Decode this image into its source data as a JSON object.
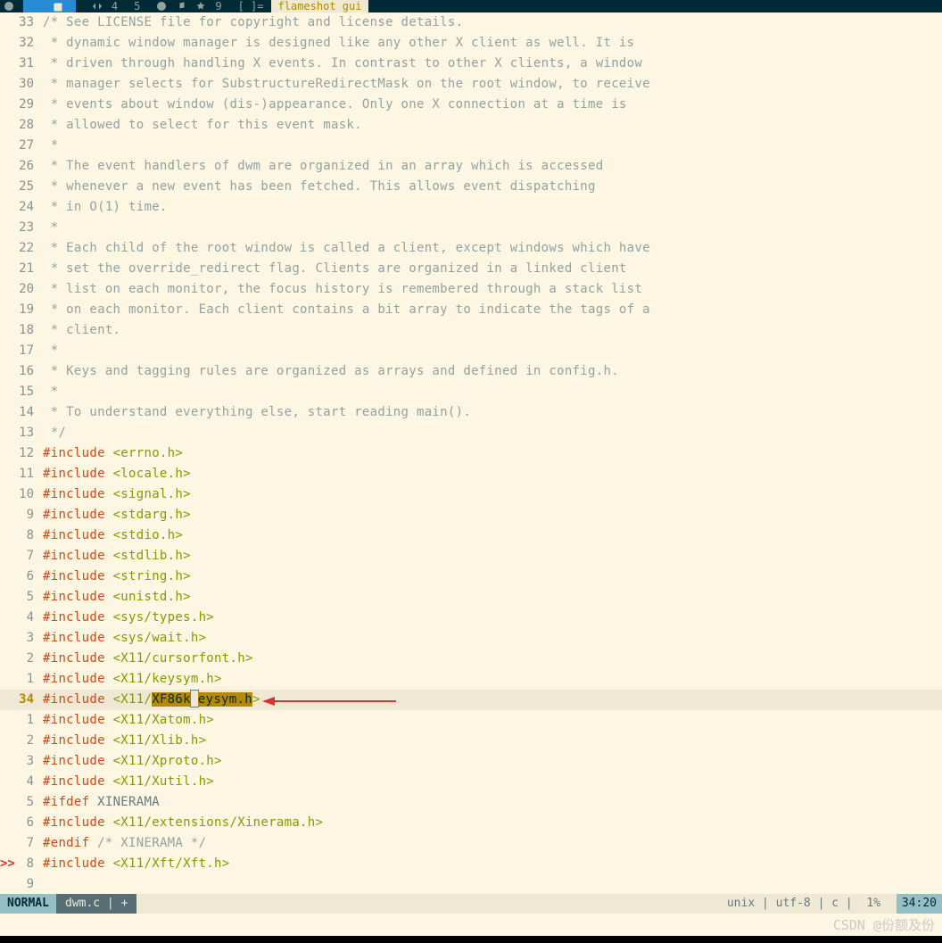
{
  "topbar": {
    "tags": [
      "",
      "",
      "",
      "4",
      "5",
      "",
      "",
      "",
      "9",
      "[ ]="
    ],
    "title": "flameshot gui"
  },
  "lines": [
    {
      "n": "33",
      "type": "comment",
      "text": "/* See LICENSE file for copyright and license details."
    },
    {
      "n": "32",
      "type": "comment",
      "text": " * dynamic window manager is designed like any other X client as well. It is"
    },
    {
      "n": "31",
      "type": "comment",
      "text": " * driven through handling X events. In contrast to other X clients, a window"
    },
    {
      "n": "30",
      "type": "comment",
      "text": " * manager selects for SubstructureRedirectMask on the root window, to receive"
    },
    {
      "n": "29",
      "type": "comment",
      "text": " * events about window (dis-)appearance. Only one X connection at a time is"
    },
    {
      "n": "28",
      "type": "comment",
      "text": " * allowed to select for this event mask."
    },
    {
      "n": "27",
      "type": "comment",
      "text": " *"
    },
    {
      "n": "26",
      "type": "comment",
      "text": " * The event handlers of dwm are organized in an array which is accessed"
    },
    {
      "n": "25",
      "type": "comment",
      "text": " * whenever a new event has been fetched. This allows event dispatching"
    },
    {
      "n": "24",
      "type": "comment",
      "text": " * in O(1) time."
    },
    {
      "n": "23",
      "type": "comment",
      "text": " *"
    },
    {
      "n": "22",
      "type": "comment",
      "text": " * Each child of the root window is called a client, except windows which have"
    },
    {
      "n": "21",
      "type": "comment",
      "text": " * set the override_redirect flag. Clients are organized in a linked client"
    },
    {
      "n": "20",
      "type": "comment",
      "text": " * list on each monitor, the focus history is remembered through a stack list"
    },
    {
      "n": "19",
      "type": "comment",
      "text": " * on each monitor. Each client contains a bit array to indicate the tags of a"
    },
    {
      "n": "18",
      "type": "comment",
      "text": " * client."
    },
    {
      "n": "17",
      "type": "comment",
      "text": " *"
    },
    {
      "n": "16",
      "type": "comment",
      "text": " * Keys and tagging rules are organized as arrays and defined in config.h."
    },
    {
      "n": "15",
      "type": "comment",
      "text": " *"
    },
    {
      "n": "14",
      "type": "comment",
      "text": " * To understand everything else, start reading main()."
    },
    {
      "n": "13",
      "type": "comment",
      "text": " */"
    },
    {
      "n": "12",
      "type": "include",
      "directive": "#include ",
      "header": "<errno.h>"
    },
    {
      "n": "11",
      "type": "include",
      "directive": "#include ",
      "header": "<locale.h>"
    },
    {
      "n": "10",
      "type": "include",
      "directive": "#include ",
      "header": "<signal.h>"
    },
    {
      "n": "9",
      "type": "include",
      "directive": "#include ",
      "header": "<stdarg.h>"
    },
    {
      "n": "8",
      "type": "include",
      "directive": "#include ",
      "header": "<stdio.h>"
    },
    {
      "n": "7",
      "type": "include",
      "directive": "#include ",
      "header": "<stdlib.h>"
    },
    {
      "n": "6",
      "type": "include",
      "directive": "#include ",
      "header": "<string.h>"
    },
    {
      "n": "5",
      "type": "include",
      "directive": "#include ",
      "header": "<unistd.h>"
    },
    {
      "n": "4",
      "type": "include",
      "directive": "#include ",
      "header": "<sys/types.h>"
    },
    {
      "n": "3",
      "type": "include",
      "directive": "#include ",
      "header": "<sys/wait.h>"
    },
    {
      "n": "2",
      "type": "include",
      "directive": "#include ",
      "header": "<X11/cursorfont.h>"
    },
    {
      "n": "1",
      "type": "include",
      "directive": "#include ",
      "header": "<X11/keysym.h>"
    },
    {
      "n": "34",
      "type": "current",
      "directive": "#include ",
      "header_pre": "<X11/",
      "header_hl1": "XF86k",
      "header_hl2": "eysym.h",
      "header_post": ">"
    },
    {
      "n": "1",
      "type": "include",
      "directive": "#include ",
      "header": "<X11/Xatom.h>"
    },
    {
      "n": "2",
      "type": "include",
      "directive": "#include ",
      "header": "<X11/Xlib.h>"
    },
    {
      "n": "3",
      "type": "include",
      "directive": "#include ",
      "header": "<X11/Xproto.h>"
    },
    {
      "n": "4",
      "type": "include",
      "directive": "#include ",
      "header": "<X11/Xutil.h>"
    },
    {
      "n": "5",
      "type": "ifdef",
      "directive": "#ifdef ",
      "ident": "XINERAMA"
    },
    {
      "n": "6",
      "type": "include",
      "directive": "#include ",
      "header": "<X11/extensions/Xinerama.h>"
    },
    {
      "n": "7",
      "type": "endif",
      "directive": "#endif ",
      "comment": "/* XINERAMA */"
    },
    {
      "n": "8",
      "type": "include_sign",
      "sign": ">>",
      "directive": "#include ",
      "header": "<X11/Xft/Xft.h>"
    },
    {
      "n": "9",
      "type": "blank",
      "text": ""
    }
  ],
  "status": {
    "mode": "NORMAL",
    "file": "dwm.c | +",
    "right": "unix | utf-8 | c |  1% ",
    "pos": "34:20"
  },
  "watermark": "CSDN @份额及份"
}
